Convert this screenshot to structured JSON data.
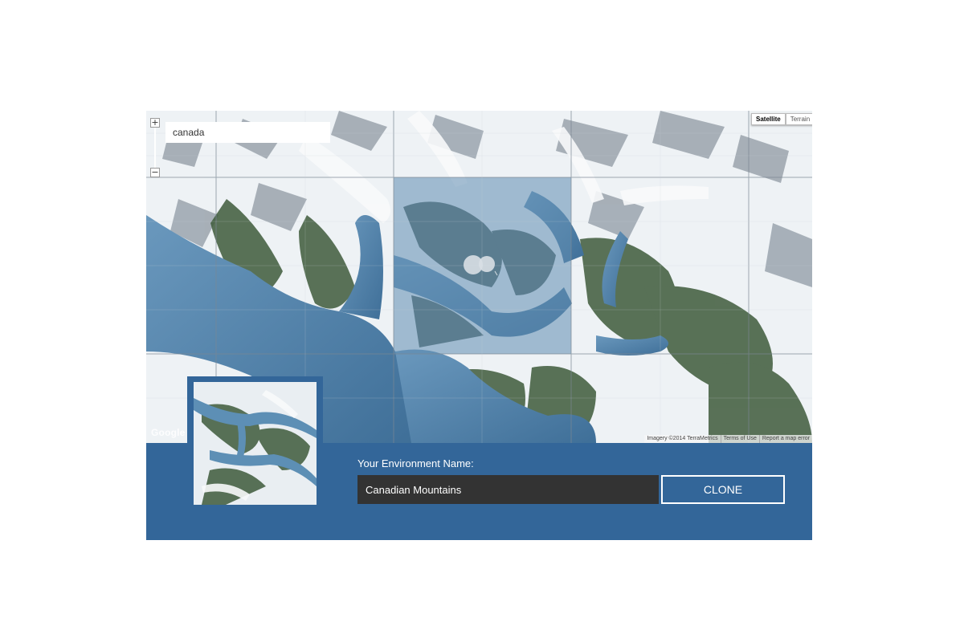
{
  "map": {
    "search_value": "canada",
    "zoom_in": "+",
    "zoom_out": "−",
    "map_types": [
      "Satellite",
      "Terrain"
    ],
    "active_map_type": "Satellite",
    "logo_text": "Google",
    "attribution": {
      "imagery": "Imagery ©2014 TerraMetrics",
      "terms": "Terms of Use",
      "report": "Report a map error"
    }
  },
  "environment": {
    "label": "Your Environment Name:",
    "name_value": "Canadian Mountains",
    "clone_label": "CLONE"
  },
  "colors": {
    "panel_blue": "#336699",
    "input_dark": "#333333",
    "water": "#4f7fa4",
    "snow": "#f2f5f7",
    "forest": "#3d5a3a"
  }
}
